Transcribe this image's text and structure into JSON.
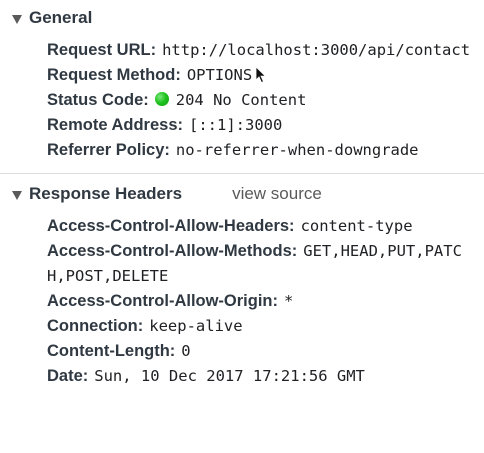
{
  "general": {
    "title": "General",
    "rows": [
      {
        "key": "Request URL:",
        "value": "http://localhost:3000/api/contact"
      },
      {
        "key": "Request Method:",
        "value": "OPTIONS"
      },
      {
        "key": "Status Code:",
        "value": "204 No Content",
        "status_color": "#21c321"
      },
      {
        "key": "Remote Address:",
        "value": "[::1]:3000"
      },
      {
        "key": "Referrer Policy:",
        "value": "no-referrer-when-downgrade"
      }
    ]
  },
  "response_headers": {
    "title": "Response Headers",
    "view_source_label": "view source",
    "rows": [
      {
        "key": "Access-Control-Allow-Headers:",
        "value": "content-type"
      },
      {
        "key": "Access-Control-Allow-Methods:",
        "value": "GET,HEAD,PUT,PATCH,POST,DELETE"
      },
      {
        "key": "Access-Control-Allow-Origin:",
        "value": "*"
      },
      {
        "key": "Connection:",
        "value": "keep-alive"
      },
      {
        "key": "Content-Length:",
        "value": "0"
      },
      {
        "key": "Date:",
        "value": "Sun, 10 Dec 2017 17:21:56 GMT"
      }
    ]
  },
  "icons": {
    "expand": "triangle-down-icon",
    "status": "status-dot-icon",
    "cursor": "mouse-cursor-icon"
  }
}
